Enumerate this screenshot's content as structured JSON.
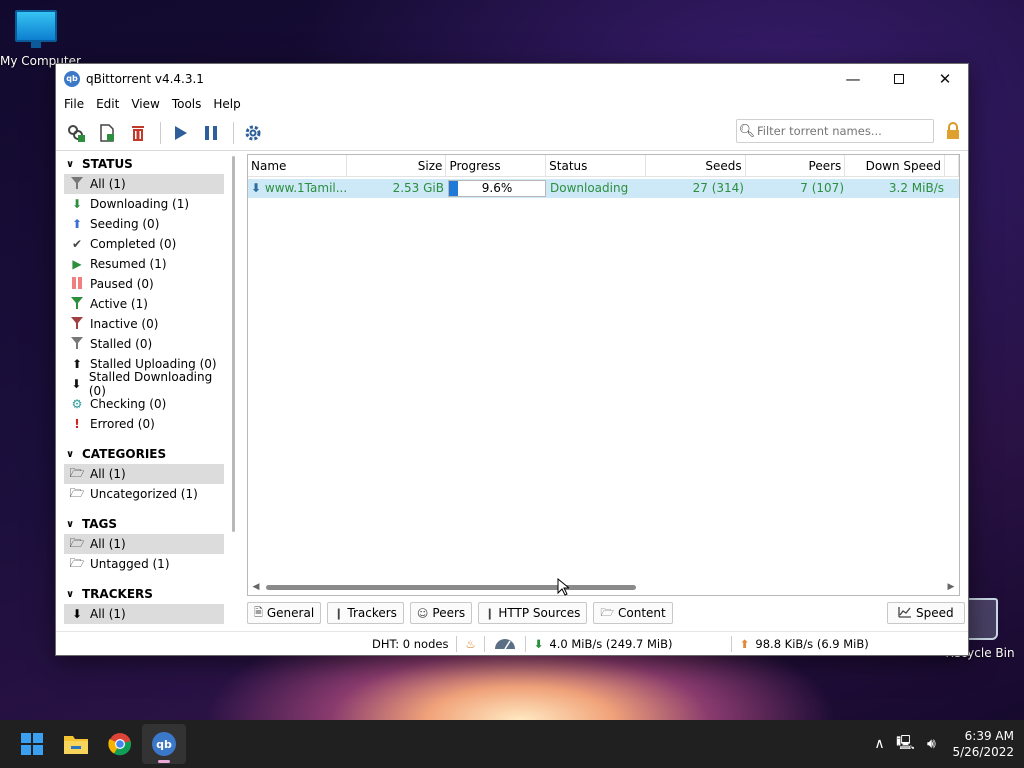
{
  "desktop": {
    "icons": [
      "My Computer",
      "Recycle Bin"
    ]
  },
  "window": {
    "title": "qBittorrent v4.4.3.1",
    "logo_text": "qb",
    "controls": [
      "minimize-icon",
      "maximize-icon",
      "close-icon"
    ]
  },
  "menu": [
    "File",
    "Edit",
    "View",
    "Tools",
    "Help"
  ],
  "toolbar": {
    "buttons": [
      "add-torrent-link-icon",
      "add-torrent-file-icon",
      "delete-icon",
      "resume-icon",
      "pause-icon",
      "options-gear-icon"
    ],
    "search_placeholder": "Filter torrent names..."
  },
  "sidebar": {
    "status_header": "STATUS",
    "status_items": [
      {
        "label": "All (1)",
        "icon": "filter-icon",
        "color": "#777777"
      },
      {
        "label": "Downloading (1)",
        "icon": "down-arrow-icon",
        "color": "#2b8f3e"
      },
      {
        "label": "Seeding (0)",
        "icon": "up-arrow-icon",
        "color": "#3a6fd8"
      },
      {
        "label": "Completed (0)",
        "icon": "checkmark-icon",
        "color": "#444444"
      },
      {
        "label": "Resumed (1)",
        "icon": "play-icon",
        "color": "#2b8f3e"
      },
      {
        "label": "Paused (0)",
        "icon": "pause-icon",
        "color": "#f08080"
      },
      {
        "label": "Active (1)",
        "icon": "filter-icon",
        "color": "#2b8f3e"
      },
      {
        "label": "Inactive (0)",
        "icon": "filter-icon",
        "color": "#a04040"
      },
      {
        "label": "Stalled (0)",
        "icon": "filter-icon",
        "color": "#777777"
      },
      {
        "label": "Stalled Uploading (0)",
        "icon": "up-arrow-icon",
        "color": "#111111"
      },
      {
        "label": "Stalled Downloading (0)",
        "icon": "down-arrow-icon",
        "color": "#111111"
      },
      {
        "label": "Checking (0)",
        "icon": "checking-gear-icon",
        "color": "#2a9a9a"
      },
      {
        "label": "Errored (0)",
        "icon": "error-icon",
        "color": "#d42020"
      }
    ],
    "categories_header": "CATEGORIES",
    "categories_items": [
      "All (1)",
      "Uncategorized (1)"
    ],
    "tags_header": "TAGS",
    "tags_items": [
      "All (1)",
      "Untagged (1)"
    ],
    "trackers_header": "TRACKERS",
    "trackers_items": [
      "All (1)"
    ]
  },
  "transfer_list": {
    "columns": [
      "Name",
      "Size",
      "Progress",
      "Status",
      "Seeds",
      "Peers",
      "Down Speed"
    ],
    "rows": [
      {
        "name": "www.1Tamil...",
        "size": "2.53 GiB",
        "progress_text": "9.6%",
        "progress_value": 0.096,
        "status": "Downloading",
        "seeds": "27 (314)",
        "peers": "7 (107)",
        "down_speed": "3.2 MiB/s"
      }
    ]
  },
  "tabs": [
    "General",
    "Trackers",
    "Peers",
    "HTTP Sources",
    "Content"
  ],
  "speed_tab": "Speed",
  "statusbar": {
    "dht": "DHT: 0 nodes",
    "download": "4.0 MiB/s (249.7 MiB)",
    "upload": "98.8 KiB/s (6.9 MiB)"
  },
  "taskbar": {
    "apps": [
      "start-icon",
      "file-explorer-icon",
      "chrome-icon",
      "qbittorrent-icon"
    ],
    "time": "6:39 AM",
    "date": "5/26/2022"
  },
  "colors": {
    "download_green": "#2b8f3e",
    "selection_blue": "#cde8f7",
    "progress_blue": "#1e7ad6"
  }
}
